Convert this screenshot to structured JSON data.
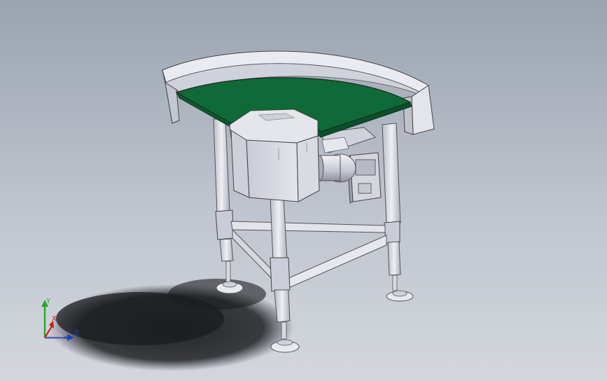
{
  "viewport": {
    "background_top": "#9aa3b0",
    "background_bottom": "#d3d7dd",
    "belt_color": "#0e6a37",
    "frame_color": "#d8dbe3",
    "model_description_visible": false
  },
  "triad": {
    "x_label": "X",
    "y_label": "Y",
    "z_label": "Z",
    "x_color": "#d21a1a",
    "y_color": "#22aa22",
    "z_color": "#1e3fd0"
  }
}
